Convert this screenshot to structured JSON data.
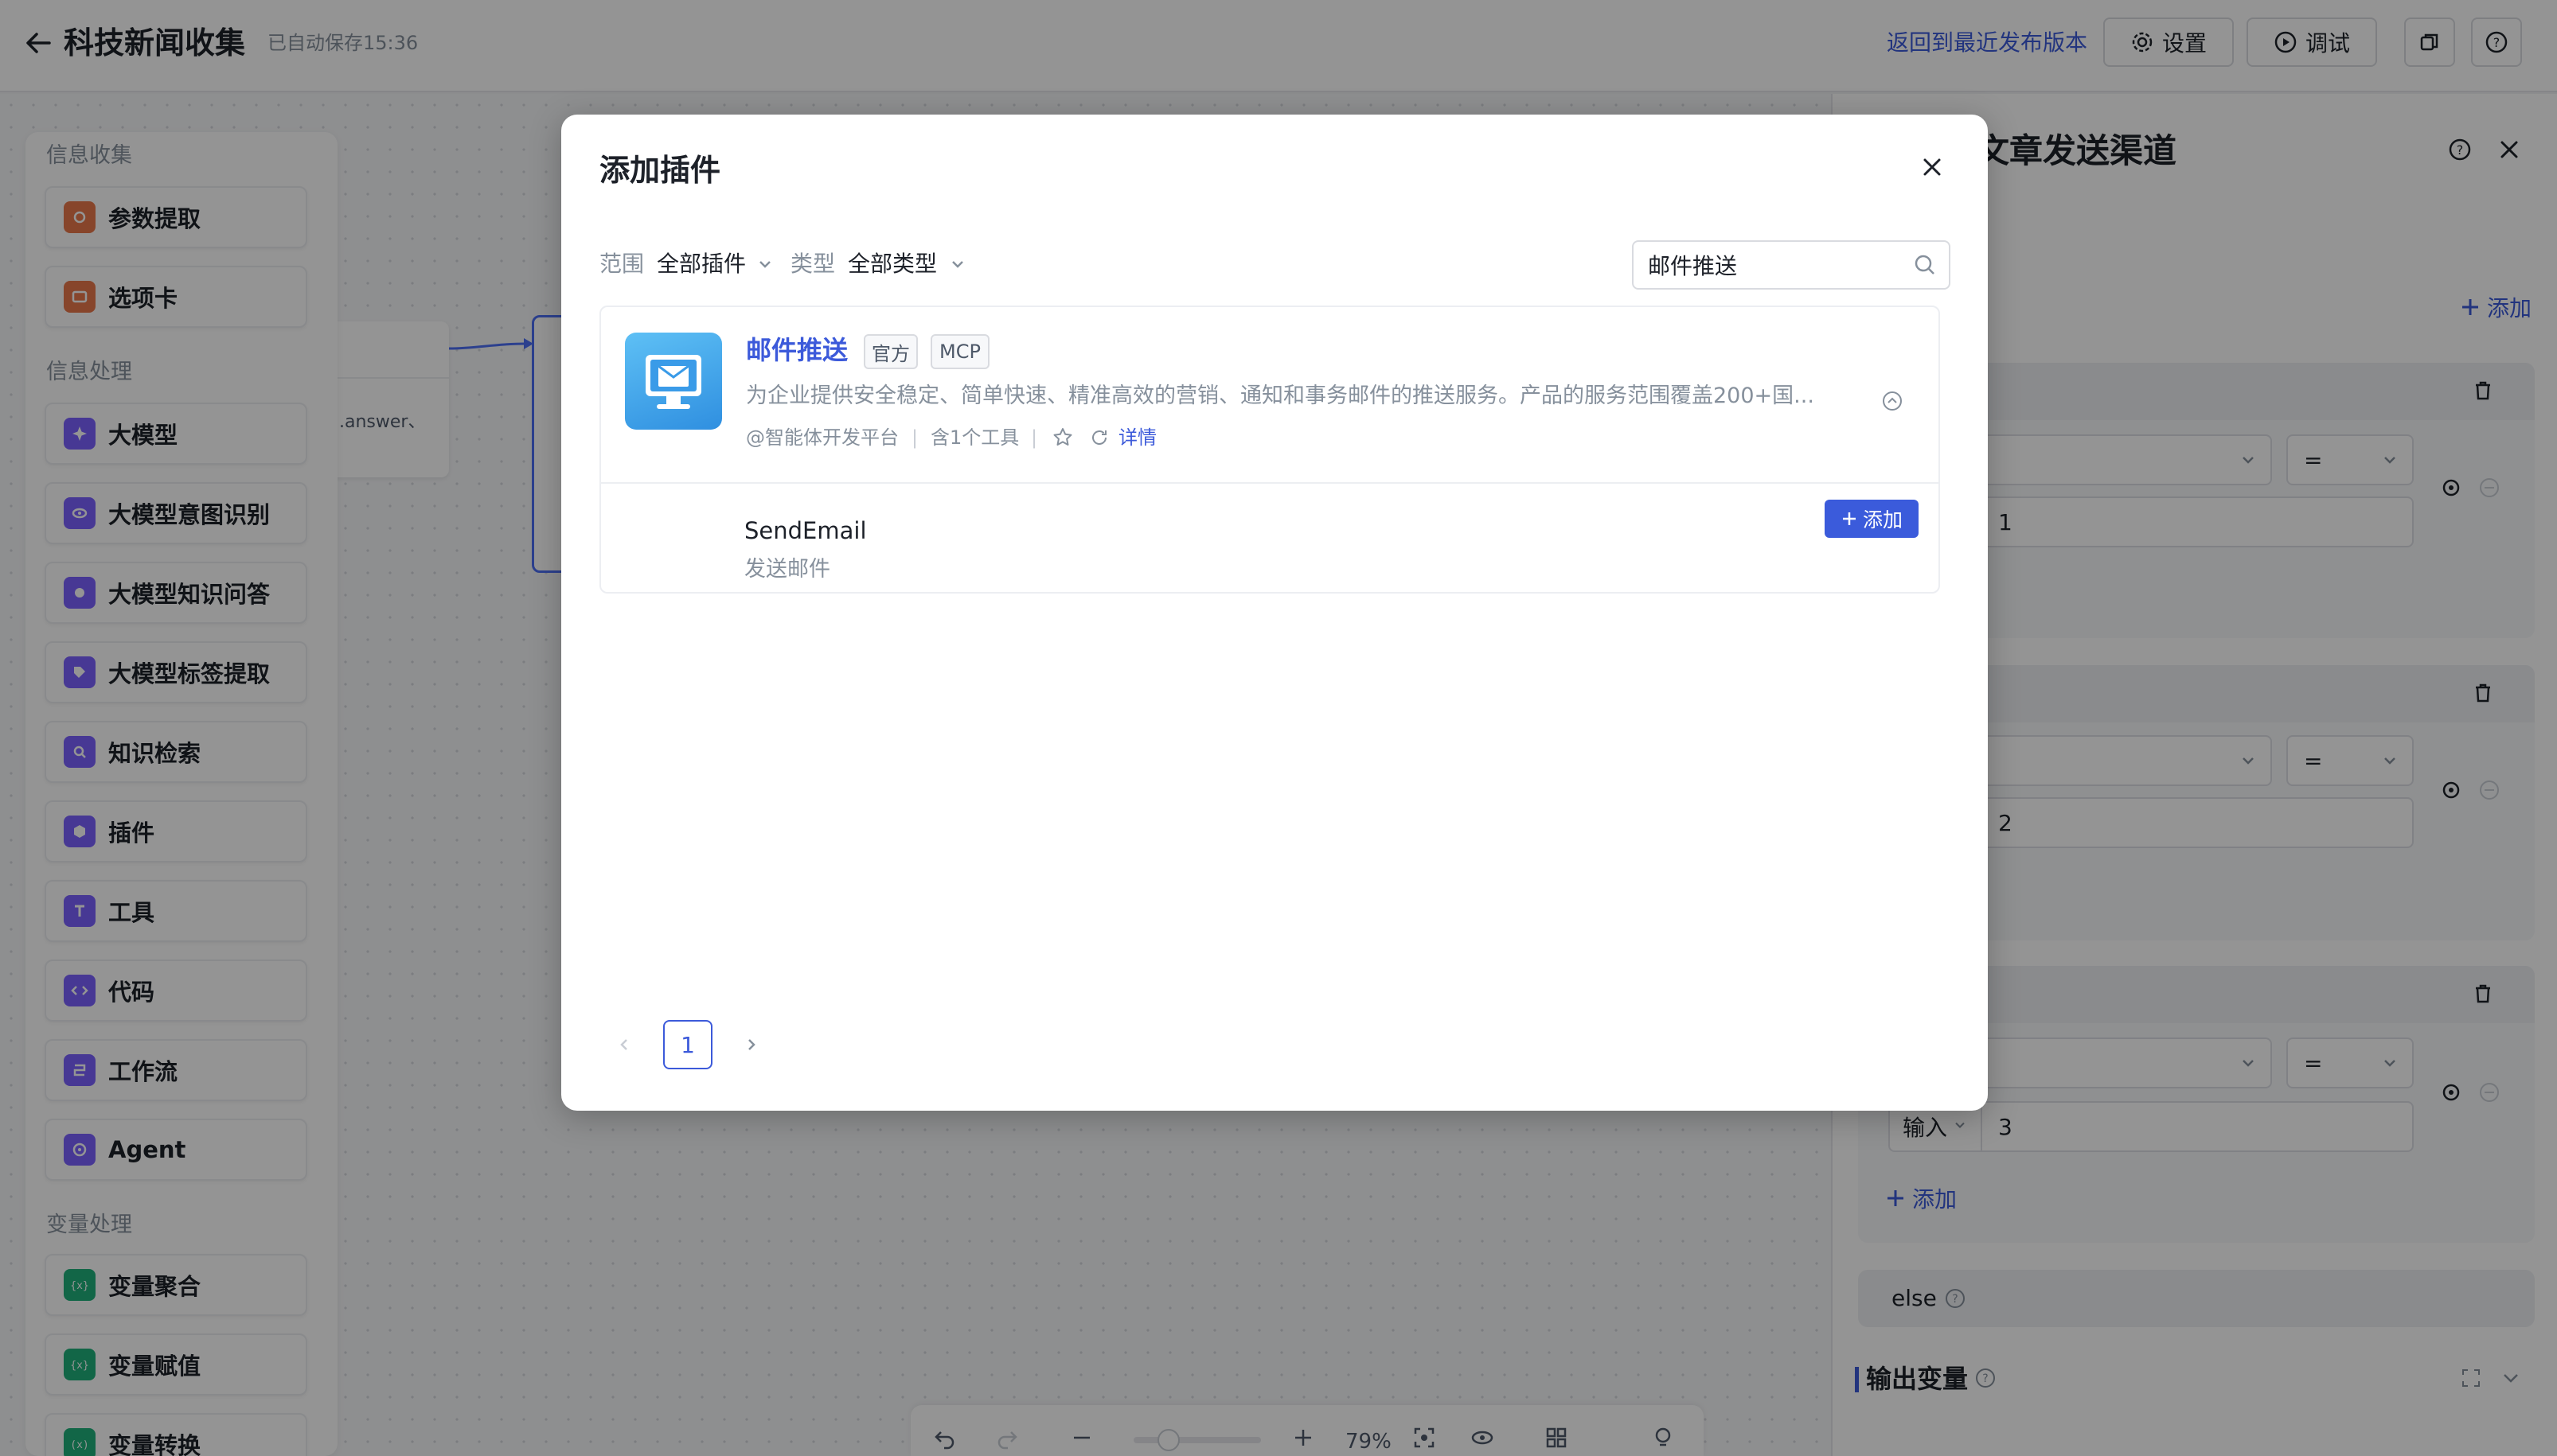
{
  "header": {
    "title": "科技新闻收集",
    "autosave": "已自动保存15:36",
    "revert_link": "返回到最近发布版本",
    "settings_label": "设置",
    "debug_label": "调试"
  },
  "palette": {
    "categories": [
      "信息收集",
      "信息处理",
      "变量处理"
    ],
    "items": [
      {
        "label": "参数提取",
        "color": "#e8784a"
      },
      {
        "label": "选项卡",
        "color": "#e8784a"
      },
      {
        "label": "大模型",
        "color": "#7b61ff"
      },
      {
        "label": "大模型意图识别",
        "color": "#7b61ff"
      },
      {
        "label": "大模型知识问答",
        "color": "#7b61ff"
      },
      {
        "label": "大模型标签提取",
        "color": "#7b61ff"
      },
      {
        "label": "知识检索",
        "color": "#7b61ff"
      },
      {
        "label": "插件",
        "color": "#7b61ff"
      },
      {
        "label": "工具",
        "color": "#7b61ff"
      },
      {
        "label": "代码",
        "color": "#7b61ff"
      },
      {
        "label": "工作流",
        "color": "#7b61ff"
      },
      {
        "label": "Agent",
        "color": "#7b61ff"
      },
      {
        "label": "变量聚合",
        "color": "#20b07a"
      },
      {
        "label": "变量赋值",
        "color": "#20b07a"
      },
      {
        "label": "变量转换",
        "color": "#20b07a"
      }
    ]
  },
  "canvas": {
    "node_text": ".answer、"
  },
  "right_panel": {
    "title_fragment": "文章发送渠道",
    "add_label": "添加",
    "conditions": [
      {
        "operator": "=",
        "value": "1"
      },
      {
        "operator": "=",
        "value": "2"
      },
      {
        "operator": "=",
        "value": "3",
        "input_type": "输入"
      }
    ],
    "add_condition_label": "添加",
    "else_label": "else",
    "output_label": "输出变量"
  },
  "zoom": {
    "level": "79%"
  },
  "modal": {
    "title": "添加插件",
    "scope_label": "范围",
    "scope_value": "全部插件",
    "type_label": "类型",
    "type_value": "全部类型",
    "search_value": "邮件推送",
    "plugin": {
      "name": "邮件推送",
      "tags": [
        "官方",
        "MCP"
      ],
      "description": "为企业提供安全稳定、简单快速、精准高效的营销、通知和事务邮件的推送服务。产品的服务范围覆盖200+国...",
      "publisher": "@智能体开发平台",
      "tool_count": "含1个工具",
      "detail_link": "详情",
      "tool": {
        "name": "SendEmail",
        "description": "发送邮件",
        "add_label": "添加"
      }
    },
    "pagination": {
      "current": "1"
    }
  }
}
